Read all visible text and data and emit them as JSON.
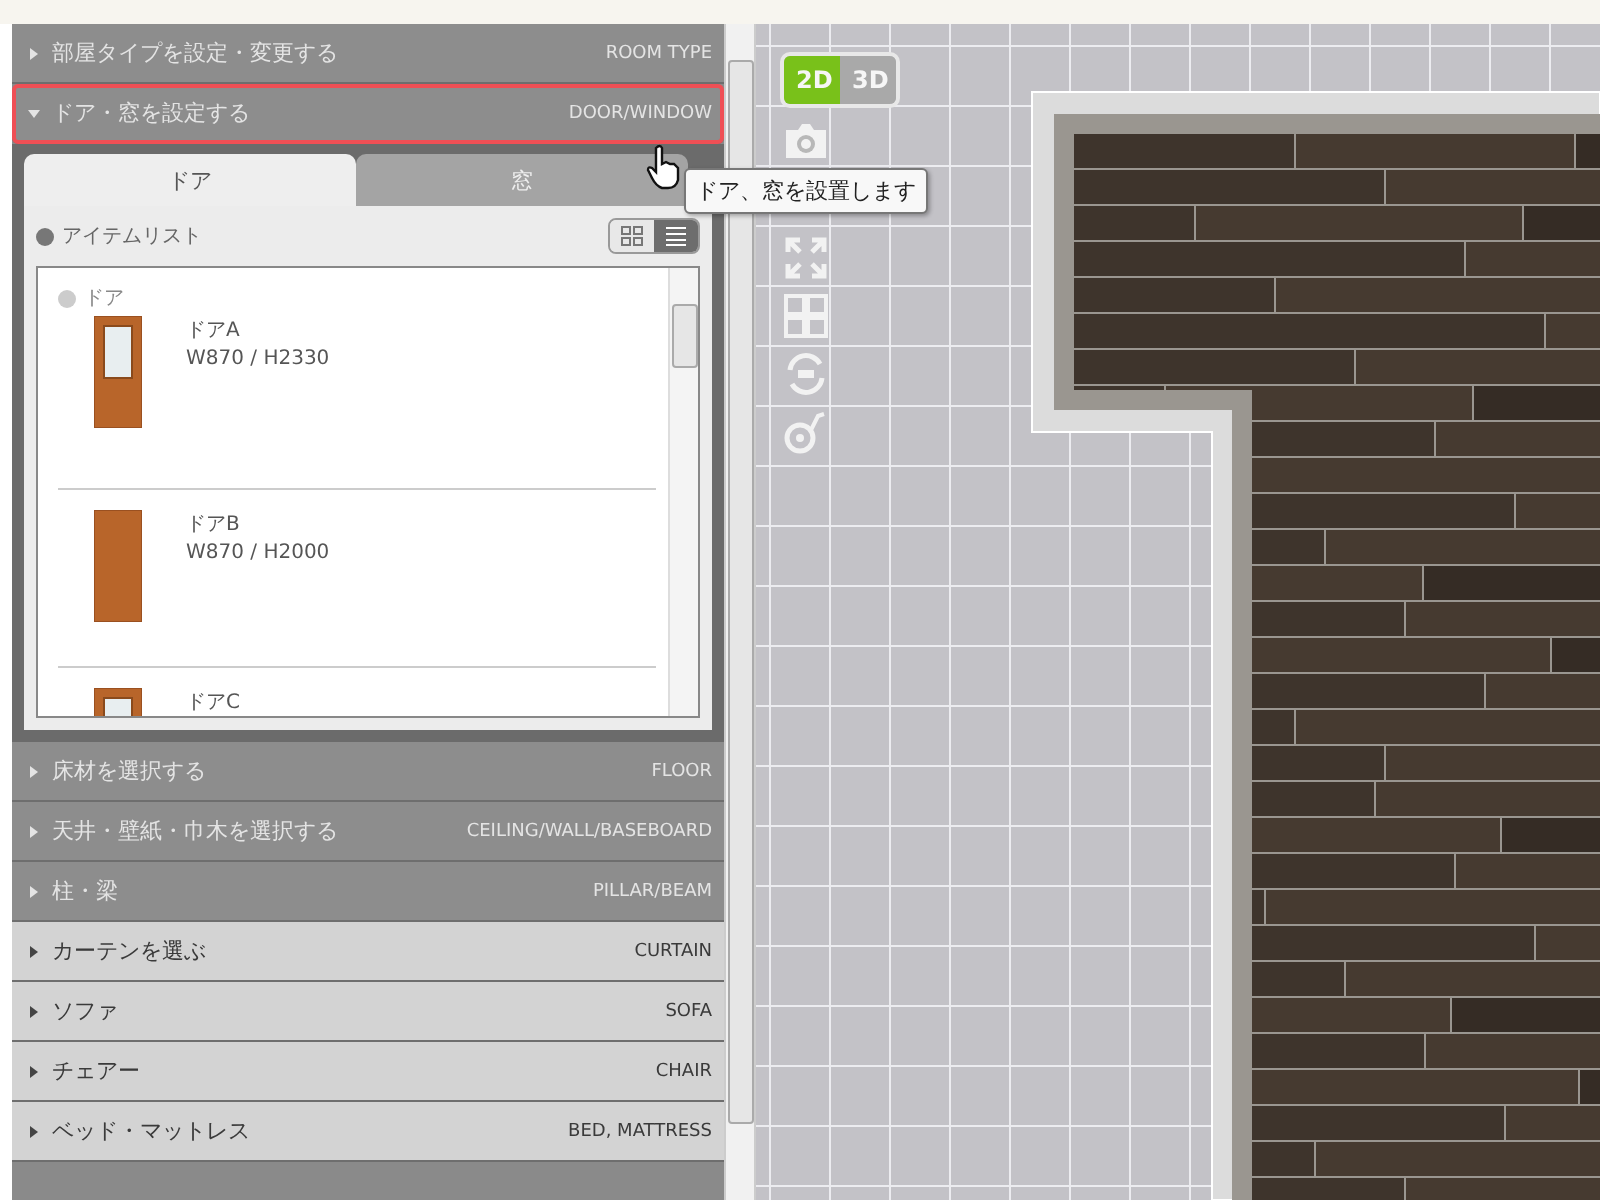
{
  "sections": [
    {
      "label": "部屋タイプを設定・変更する",
      "label_en": "ROOM TYPE",
      "kind": "building",
      "expanded": false,
      "highlighted": false
    },
    {
      "label": "ドア・窓を設定する",
      "label_en": "DOOR/WINDOW",
      "kind": "building",
      "expanded": true,
      "highlighted": true
    },
    {
      "label": "床材を選択する",
      "label_en": "FLOOR",
      "kind": "building",
      "expanded": false,
      "highlighted": false
    },
    {
      "label": "天井・壁紙・巾木を選択する",
      "label_en": "CEILING/WALL/BASEBOARD",
      "kind": "building",
      "expanded": false,
      "highlighted": false
    },
    {
      "label": "柱・梁",
      "label_en": "PILLAR/BEAM",
      "kind": "building",
      "expanded": false,
      "highlighted": false
    },
    {
      "label": "カーテンを選ぶ",
      "label_en": "CURTAIN",
      "kind": "furniture",
      "expanded": false,
      "highlighted": false
    },
    {
      "label": "ソファ",
      "label_en": "SOFA",
      "kind": "furniture",
      "expanded": false,
      "highlighted": false
    },
    {
      "label": "チェアー",
      "label_en": "CHAIR",
      "kind": "furniture",
      "expanded": false,
      "highlighted": false
    },
    {
      "label": "ベッド・マットレス",
      "label_en": "BED, MATTRESS",
      "kind": "furniture",
      "expanded": false,
      "highlighted": false
    }
  ],
  "door_panel": {
    "tabs": [
      {
        "label": "ドア",
        "selected": true
      },
      {
        "label": "窓",
        "selected": false
      }
    ],
    "list_title": "アイテムリスト",
    "views": [
      {
        "kind": "grid",
        "selected": false
      },
      {
        "kind": "list",
        "selected": true
      }
    ],
    "category": "ドア",
    "items": [
      {
        "name": "ドアA",
        "size": "W870 / H2330",
        "kind": "glass"
      },
      {
        "name": "ドアB",
        "size": "W870 / H2000",
        "kind": "plain"
      },
      {
        "name": "ドアC",
        "kind": "glass"
      }
    ]
  },
  "view_modes": [
    {
      "label": "2D",
      "selected": true
    },
    {
      "label": "3D",
      "selected": false
    }
  ],
  "tooltip": "ドア、窓を設置します"
}
